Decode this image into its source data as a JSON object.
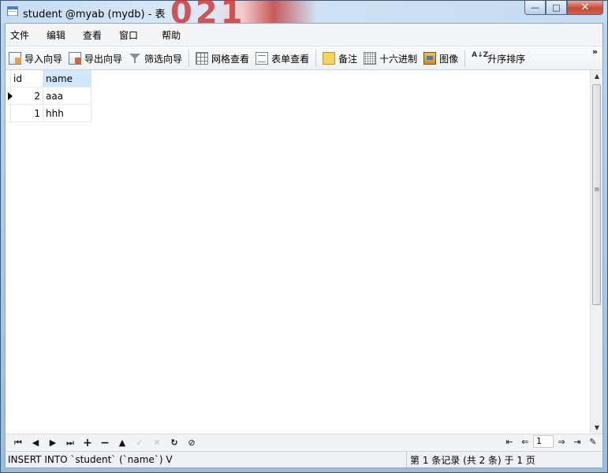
{
  "window": {
    "title": "student @myab (mydb) - 表",
    "min_glyph": "—",
    "max_glyph": "□",
    "close_glyph": "✕"
  },
  "menu": [
    "文件",
    "编辑",
    "查看",
    "窗口",
    "帮助"
  ],
  "toolbar": {
    "import_wizard": "导入向导",
    "export_wizard": "导出向导",
    "filter_wizard": "筛选向导",
    "grid_view": "网格查看",
    "form_view": "表单查看",
    "memo": "备注",
    "hex": "十六进制",
    "image": "图像",
    "sort_asc": "升序排序",
    "sort_icon_glyph": "A↓Z",
    "more": "»"
  },
  "table": {
    "columns": [
      "id",
      "name"
    ],
    "rows": [
      {
        "id": "2",
        "name": "aaa",
        "current": true
      },
      {
        "id": "1",
        "name": "hhh",
        "current": false
      }
    ]
  },
  "navigator": {
    "first": "⏮",
    "prev": "◀",
    "next": "▶",
    "last": "⏭",
    "add": "+",
    "delete": "−",
    "apply": "▲",
    "check": "✓",
    "cancel": "✕",
    "refresh": "↻",
    "stop": "⊘",
    "page_first": "⇤",
    "page_prev": "⇐",
    "page": "1",
    "page_next": "⇒",
    "page_last": "⇥",
    "settings": "✎"
  },
  "status": {
    "sql": "INSERT INTO `student` (`name`) V",
    "record_info": "第 1 条记录 (共 2 条) 于 1 页"
  },
  "colors": {
    "header_selected": "#cfe9fb",
    "close_button": "#c74a35",
    "title_accent": "#d03a3a"
  }
}
